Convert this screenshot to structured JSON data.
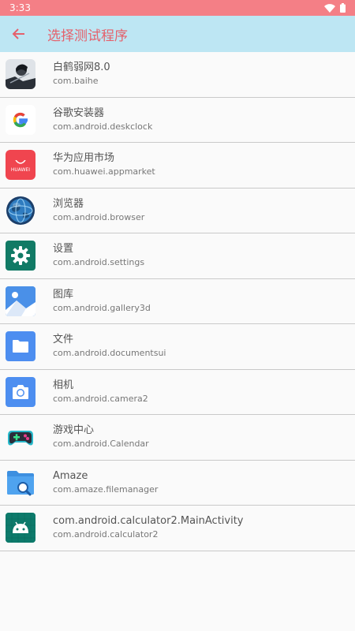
{
  "status_bar": {
    "time": "3:33"
  },
  "app_bar": {
    "title": "选择测试程序"
  },
  "apps": [
    {
      "name": "白鹤弱网8.0",
      "package": "com.baihe",
      "icon": "baihe-avatar-icon"
    },
    {
      "name": "谷歌安装器",
      "package": "com.android.deskclock",
      "icon": "google-g-icon"
    },
    {
      "name": "华为应用市场",
      "package": "com.huawei.appmarket",
      "icon": "huawei-appgallery-icon",
      "icon_text": "HUAWEI"
    },
    {
      "name": "浏览器",
      "package": "com.android.browser",
      "icon": "globe-icon"
    },
    {
      "name": "设置",
      "package": "com.android.settings",
      "icon": "gear-icon"
    },
    {
      "name": "图库",
      "package": "com.android.gallery3d",
      "icon": "gallery-icon"
    },
    {
      "name": "文件",
      "package": "com.android.documentsui",
      "icon": "folder-icon"
    },
    {
      "name": "相机",
      "package": "com.android.camera2",
      "icon": "camera-icon"
    },
    {
      "name": "游戏中心",
      "package": "com.android.Calendar",
      "icon": "gamepad-icon"
    },
    {
      "name": "Amaze",
      "package": "com.amaze.filemanager",
      "icon": "folder-search-icon"
    },
    {
      "name": "com.android.calculator2.MainActivity",
      "package": "com.android.calculator2",
      "icon": "android-robot-icon"
    }
  ],
  "colors": {
    "status_bar": "#f47f86",
    "app_bar": "#bde6f3",
    "title": "#e5606b"
  }
}
